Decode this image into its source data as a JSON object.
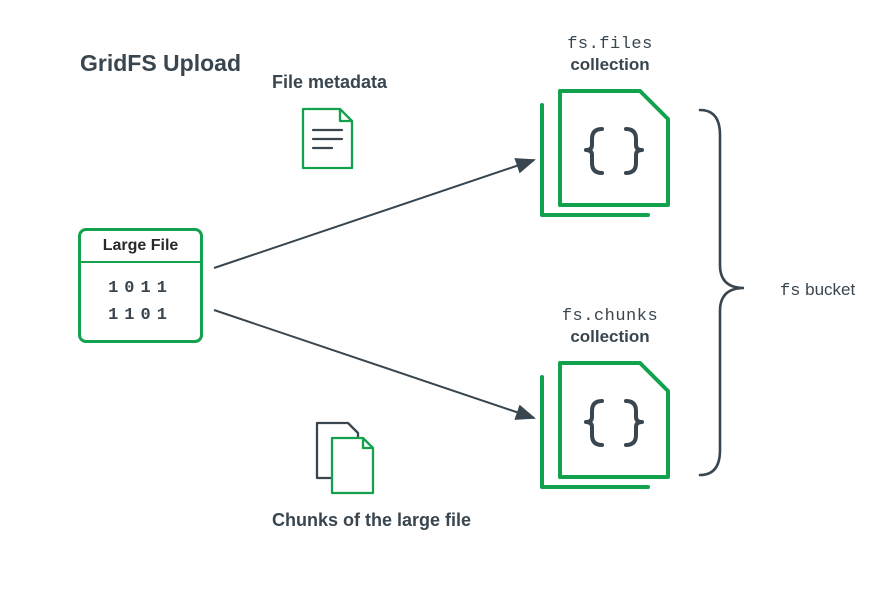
{
  "title": "GridFS Upload",
  "large_file": {
    "title": "Large File",
    "row1": "1011",
    "row2": "1101"
  },
  "metadata_label": "File metadata",
  "chunks_label": "Chunks of the large file",
  "files_collection": {
    "name": "fs.files",
    "sub": "collection"
  },
  "chunks_collection": {
    "name": "fs.chunks",
    "sub": "collection"
  },
  "bucket": {
    "prefix": "fs",
    "word": " bucket"
  },
  "colors": {
    "green": "#12a24e",
    "dark": "#3a464f"
  }
}
